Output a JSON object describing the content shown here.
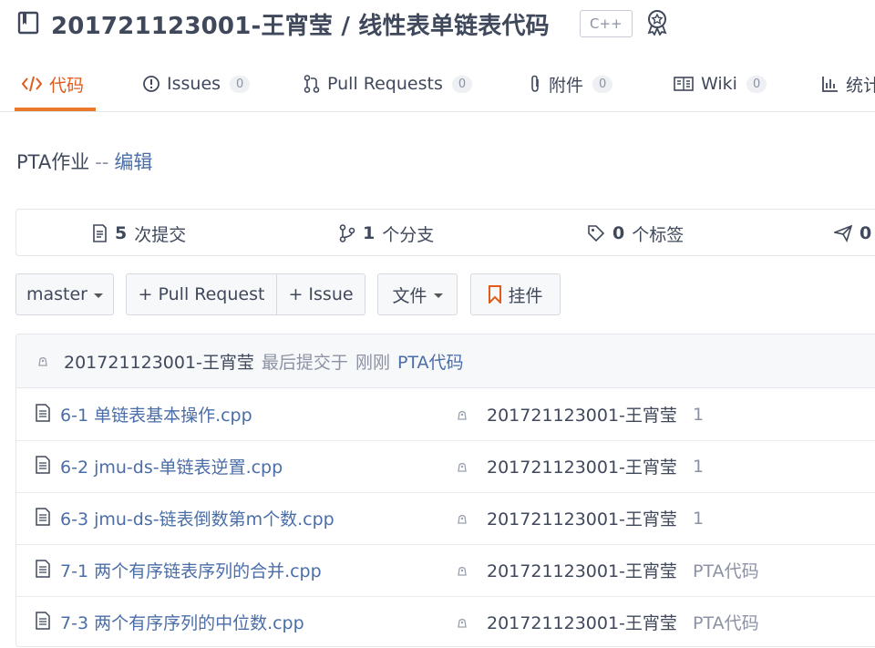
{
  "header": {
    "repo_title": "201721123001-王宵莹 / 线性表单链表代码",
    "language_badge": "C++",
    "icons": {
      "repo": "repo-book-icon",
      "award": "award-icon"
    }
  },
  "tabs": [
    {
      "label": "代码",
      "icon": "code-icon",
      "active": true
    },
    {
      "label": "Issues",
      "count": "0",
      "icon": "issues-icon"
    },
    {
      "label": "Pull Requests",
      "count": "0",
      "icon": "pull-request-icon"
    },
    {
      "label": "附件",
      "count": "0",
      "icon": "paperclip-icon"
    },
    {
      "label": "Wiki",
      "count": "0",
      "icon": "wiki-icon"
    },
    {
      "label": "统计",
      "icon": "stats-icon"
    }
  ],
  "description": {
    "text": "PTA作业",
    "separator": "--",
    "edit_link": "编辑"
  },
  "stats": [
    {
      "count": "5",
      "label": "次提交",
      "icon": "commits-icon"
    },
    {
      "count": "1",
      "label": "个分支",
      "icon": "branch-icon"
    },
    {
      "count": "0",
      "label": "个标签",
      "icon": "tag-icon"
    },
    {
      "count": "0",
      "label": "",
      "icon": "release-icon"
    }
  ],
  "toolbar": {
    "branch": "master",
    "pull_request": "+ Pull Request",
    "issue": "+ Issue",
    "file_menu": "文件",
    "widget": "挂件"
  },
  "latest_commit": {
    "author": "201721123001-王宵莹",
    "prefix": "最后提交于",
    "time": "刚刚",
    "message": "PTA代码"
  },
  "files": [
    {
      "name": "6-1 单链表基本操作.cpp",
      "author": "201721123001-王宵莹",
      "message": "1"
    },
    {
      "name": "6-2 jmu-ds-单链表逆置.cpp",
      "author": "201721123001-王宵莹",
      "message": "1"
    },
    {
      "name": "6-3 jmu-ds-链表倒数第m个数.cpp",
      "author": "201721123001-王宵莹",
      "message": "1"
    },
    {
      "name": "7-1 两个有序链表序列的合并.cpp",
      "author": "201721123001-王宵莹",
      "message": "PTA代码"
    },
    {
      "name": "7-3 两个有序序列的中位数.cpp",
      "author": "201721123001-王宵莹",
      "message": "PTA代码"
    }
  ],
  "colors": {
    "accent": "#e35b1b",
    "link": "#4b6ea8",
    "muted": "#8c92a4",
    "text": "#40485b"
  }
}
